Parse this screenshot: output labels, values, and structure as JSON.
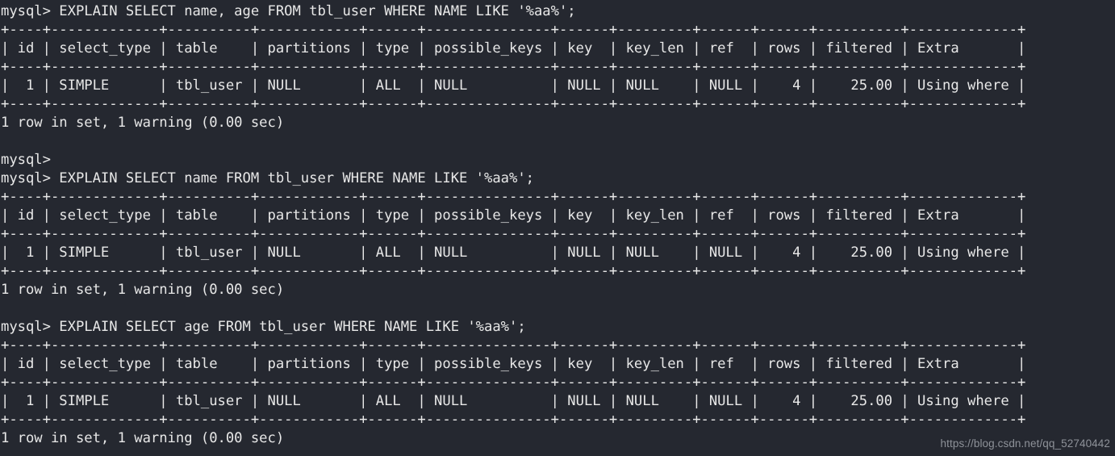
{
  "terminal": {
    "app": "mysql-client",
    "background_color": "#252830",
    "text_color": "#e8e8e8",
    "prompt": "mysql>",
    "lines": [
      "mysql> EXPLAIN SELECT name, age FROM tbl_user WHERE NAME LIKE '%aa%';",
      "+----+-------------+----------+------------+------+---------------+------+---------+------+------+----------+-------------+",
      "| id | select_type | table    | partitions | type | possible_keys | key  | key_len | ref  | rows | filtered | Extra       |",
      "+----+-------------+----------+------------+------+---------------+------+---------+------+------+----------+-------------+",
      "|  1 | SIMPLE      | tbl_user | NULL       | ALL  | NULL          | NULL | NULL    | NULL |    4 |    25.00 | Using where |",
      "+----+-------------+----------+------------+------+---------------+------+---------+------+------+----------+-------------+",
      "1 row in set, 1 warning (0.00 sec)",
      "",
      "mysql>",
      "mysql> EXPLAIN SELECT name FROM tbl_user WHERE NAME LIKE '%aa%';",
      "+----+-------------+----------+------------+------+---------------+------+---------+------+------+----------+-------------+",
      "| id | select_type | table    | partitions | type | possible_keys | key  | key_len | ref  | rows | filtered | Extra       |",
      "+----+-------------+----------+------------+------+---------------+------+---------+------+------+----------+-------------+",
      "|  1 | SIMPLE      | tbl_user | NULL       | ALL  | NULL          | NULL | NULL    | NULL |    4 |    25.00 | Using where |",
      "+----+-------------+----------+------------+------+---------------+------+---------+------+------+----------+-------------+",
      "1 row in set, 1 warning (0.00 sec)",
      "",
      "mysql> EXPLAIN SELECT age FROM tbl_user WHERE NAME LIKE '%aa%';",
      "+----+-------------+----------+------------+------+---------------+------+---------+------+------+----------+-------------+",
      "| id | select_type | table    | partitions | type | possible_keys | key  | key_len | ref  | rows | filtered | Extra       |",
      "+----+-------------+----------+------------+------+---------------+------+---------+------+------+----------+-------------+",
      "|  1 | SIMPLE      | tbl_user | NULL       | ALL  | NULL          | NULL | NULL    | NULL |    4 |    25.00 | Using where |",
      "+----+-------------+----------+------------+------+---------------+------+---------+------+------+----------+-------------+",
      "1 row in set, 1 warning (0.00 sec)"
    ],
    "queries": [
      {
        "command": "EXPLAIN SELECT name, age FROM tbl_user WHERE NAME LIKE '%aa%';",
        "status": "1 row in set, 1 warning (0.00 sec)"
      },
      {
        "command": "EXPLAIN SELECT name FROM tbl_user WHERE NAME LIKE '%aa%';",
        "status": "1 row in set, 1 warning (0.00 sec)"
      },
      {
        "command": "EXPLAIN SELECT age FROM tbl_user WHERE NAME LIKE '%aa%';",
        "status": "1 row in set, 1 warning (0.00 sec)"
      }
    ],
    "explain_table": {
      "columns": [
        "id",
        "select_type",
        "table",
        "partitions",
        "type",
        "possible_keys",
        "key",
        "key_len",
        "ref",
        "rows",
        "filtered",
        "Extra"
      ],
      "rows": [
        [
          "1",
          "SIMPLE",
          "tbl_user",
          "NULL",
          "ALL",
          "NULL",
          "NULL",
          "NULL",
          "NULL",
          "4",
          "25.00",
          "Using where"
        ]
      ]
    }
  },
  "watermark": {
    "text": "https://blog.csdn.net/qq_52740442"
  }
}
